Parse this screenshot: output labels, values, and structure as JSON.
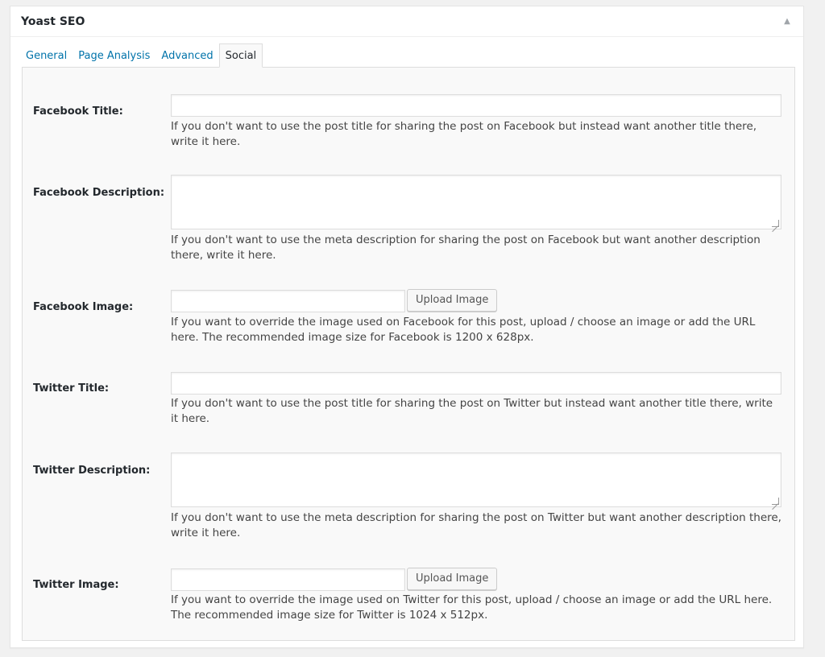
{
  "panel": {
    "title": "Yoast SEO",
    "toggle_icon": "triangle-up-icon"
  },
  "tabs": [
    {
      "label": "General",
      "active": false
    },
    {
      "label": "Page Analysis",
      "active": false
    },
    {
      "label": "Advanced",
      "active": false
    },
    {
      "label": "Social",
      "active": true
    }
  ],
  "fields": {
    "facebook_title": {
      "label": "Facebook Title:",
      "value": "",
      "help": "If you don't want to use the post title for sharing the post on Facebook but instead want another title there, write it here."
    },
    "facebook_description": {
      "label": "Facebook Description:",
      "value": "",
      "help": "If you don't want to use the meta description for sharing the post on Facebook but want another description there, write it here."
    },
    "facebook_image": {
      "label": "Facebook Image:",
      "value": "",
      "button": "Upload Image",
      "help": "If you want to override the image used on Facebook for this post, upload / choose an image or add the URL here. The recommended image size for Facebook is 1200 x 628px."
    },
    "twitter_title": {
      "label": "Twitter Title:",
      "value": "",
      "help": "If you don't want to use the post title for sharing the post on Twitter but instead want another title there, write it here."
    },
    "twitter_description": {
      "label": "Twitter Description:",
      "value": "",
      "help": "If you don't want to use the meta description for sharing the post on Twitter but want another description there, write it here."
    },
    "twitter_image": {
      "label": "Twitter Image:",
      "value": "",
      "button": "Upload Image",
      "help": "If you want to override the image used on Twitter for this post, upload / choose an image or add the URL here. The recommended image size for Twitter is 1024 x 512px."
    }
  }
}
